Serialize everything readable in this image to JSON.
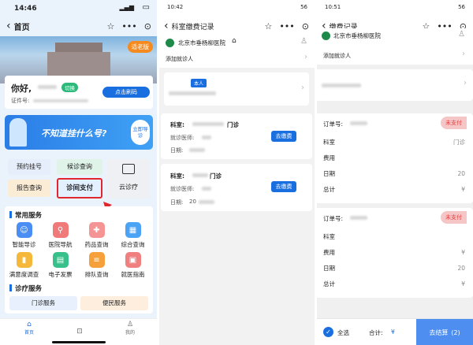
{
  "phone1": {
    "status": {
      "time": "14:46",
      "signal": "▂▄▆",
      "battery": "▭"
    },
    "header": {
      "back": "‹",
      "title": "首页",
      "icons": [
        "☆",
        "•••",
        "⊙"
      ]
    },
    "elder_badge": "适老版",
    "greeting": "你好,",
    "switch_label": "切换",
    "id_label": "证件号:",
    "scan_button": "点击刷码",
    "banner_text": "不知道挂什么号?",
    "guide_badge": "立即导诊",
    "quick_buttons": [
      "预约挂号",
      "候诊查询",
      "报告查询",
      "诊间支付",
      "云诊疗"
    ],
    "common_services_title": "常用服务",
    "services": [
      "智能导诊",
      "医院导航",
      "药品查询",
      "综合查询",
      "满意度调查",
      "电子发票",
      "排队查询",
      "就医指南"
    ],
    "diag_title": "诊疗服务",
    "diag_buttons": [
      "门诊服务",
      "便民服务"
    ],
    "tabs": [
      "首页",
      "",
      "我的"
    ]
  },
  "phone2": {
    "status": {
      "time": "10:42",
      "right": "56"
    },
    "header": {
      "back": "‹",
      "title": "科室缴费记录",
      "icons": [
        "☆",
        "•••",
        "⊙"
      ]
    },
    "hospital": "北京市垂杨柳医院",
    "add_patient": "添加就诊人",
    "self_tag": "本人",
    "records": [
      {
        "dept_label": "科室:",
        "dept_suffix": "门诊",
        "doctor_label": "就诊医师:",
        "date_label": "日期:",
        "date_prefix": "",
        "pay": "去缴费"
      },
      {
        "dept_label": "科室:",
        "dept_suffix": "门诊",
        "doctor_label": "就诊医师:",
        "date_label": "日期:",
        "date_prefix": "20",
        "pay": "去缴费"
      }
    ]
  },
  "phone3": {
    "status": {
      "time": "10:51",
      "right": "56"
    },
    "header": {
      "back": "‹",
      "title": "缴费记录",
      "icons": [
        "☆",
        "•••",
        "⊙"
      ]
    },
    "hospital": "北京市垂杨柳医院",
    "add_patient": "添加就诊人",
    "orders": [
      {
        "order_label": "订单号:",
        "status": "未支付",
        "rows": [
          {
            "k": "科室",
            "v": "门诊"
          },
          {
            "k": "费用",
            "v": ""
          },
          {
            "k": "日期",
            "v": "20"
          },
          {
            "k": "总计",
            "v": "¥"
          }
        ]
      },
      {
        "order_label": "订单号:",
        "status": "未支付",
        "rows": [
          {
            "k": "科室",
            "v": ""
          },
          {
            "k": "费用",
            "v": "¥"
          },
          {
            "k": "日期",
            "v": "20"
          },
          {
            "k": "总计",
            "v": "¥"
          }
        ]
      }
    ],
    "footer": {
      "select_all": "全选",
      "total": "合计:",
      "currency": "¥",
      "checkout": "去结算",
      "count": "(2)"
    }
  }
}
